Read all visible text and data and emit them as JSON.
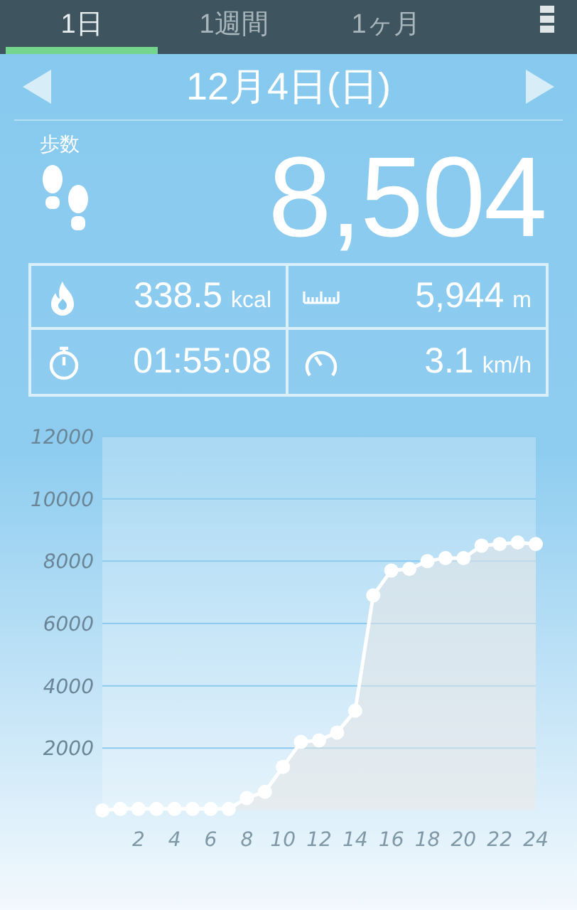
{
  "tabs": [
    {
      "label": "1日",
      "selected": true
    },
    {
      "label": "1週間",
      "selected": false
    },
    {
      "label": "1ヶ月",
      "selected": false
    }
  ],
  "date": "12月4日(日)",
  "steps": {
    "label": "歩数",
    "value": "8,504"
  },
  "stats": [
    {
      "kind": "calories",
      "value": "338.5",
      "unit": "kcal"
    },
    {
      "kind": "distance",
      "value": "5,944",
      "unit": "m"
    },
    {
      "kind": "time",
      "value": "01:55:08"
    },
    {
      "kind": "speed",
      "value": "3.1",
      "unit": "km/h"
    }
  ],
  "chart": {
    "chart_data": {
      "type": "line",
      "x": [
        0,
        1,
        2,
        3,
        4,
        5,
        6,
        7,
        8,
        9,
        10,
        11,
        12,
        13,
        14,
        15,
        16,
        17,
        18,
        19,
        20,
        21,
        22,
        23,
        24
      ],
      "grid": true,
      "series": [
        {
          "color": "#ffffff",
          "marker": "o",
          "values": [
            0,
            50,
            50,
            50,
            50,
            50,
            50,
            50,
            400,
            600,
            1400,
            2200,
            2250,
            2500,
            3200,
            6900,
            7700,
            7750,
            8000,
            8100,
            8100,
            8500,
            8550,
            8600,
            8550
          ]
        }
      ],
      "xlim": [
        0,
        24
      ],
      "ylim": [
        0,
        12000
      ],
      "xticks": [
        2,
        4,
        6,
        8,
        10,
        12,
        14,
        16,
        18,
        20,
        22,
        24
      ],
      "yticks": [
        2000,
        4000,
        6000,
        8000,
        10000,
        12000
      ]
    }
  }
}
